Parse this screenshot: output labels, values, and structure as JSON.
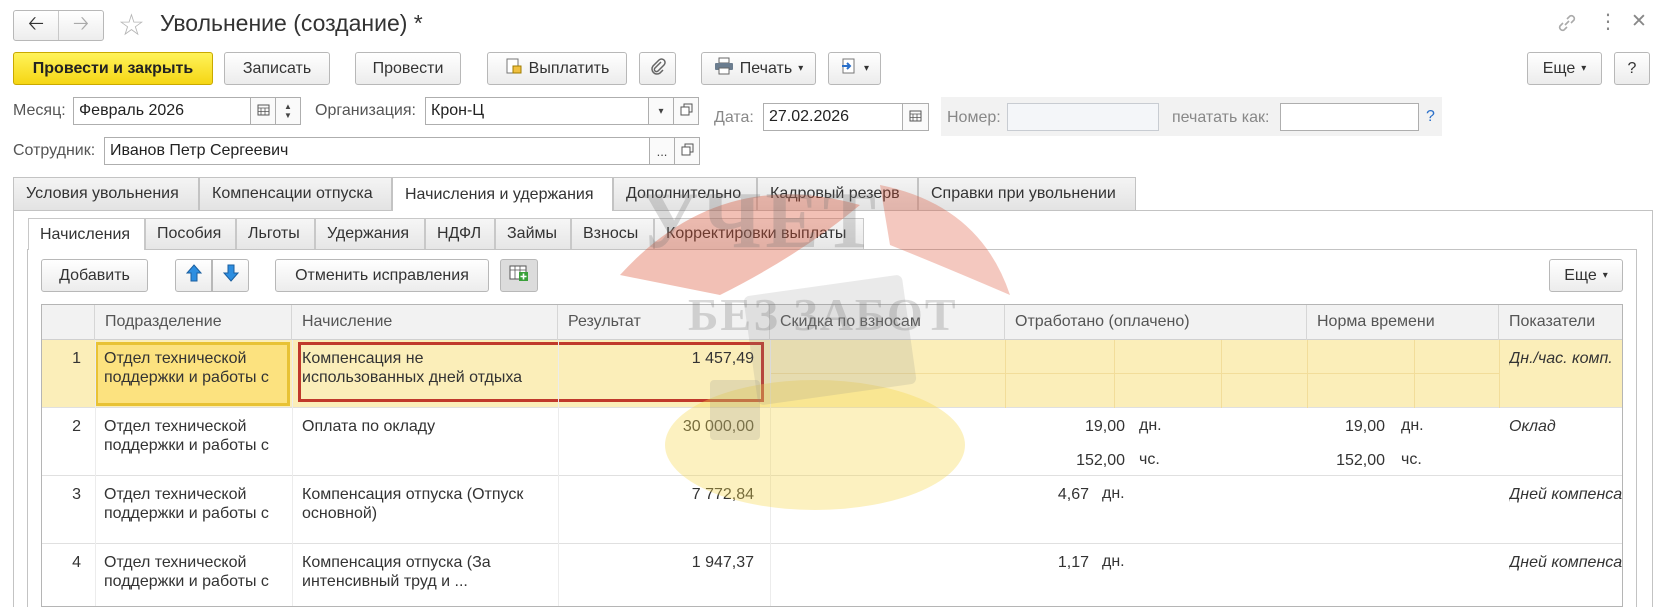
{
  "window": {
    "title": "Увольнение (создание) *"
  },
  "toolbar": {
    "post_close": "Провести и закрыть",
    "save": "Записать",
    "post": "Провести",
    "pay": "Выплатить",
    "print": "Печать",
    "more": "Еще",
    "help": "?"
  },
  "form": {
    "month_label": "Месяц:",
    "month_value": "Февраль 2026",
    "org_label": "Организация:",
    "org_value": "Крон-Ц",
    "date_label": "Дата:",
    "date_value": "27.02.2026",
    "number_label": "Номер:",
    "number_value": "",
    "print_as_label": "печатать как:",
    "print_as_value": "",
    "help_mark": "?",
    "employee_label": "Сотрудник:",
    "employee_value": "Иванов Петр Сергеевич",
    "dots": "..."
  },
  "tabs": [
    "Условия увольнения",
    "Компенсации отпуска",
    "Начисления и удержания",
    "Дополнительно",
    "Кадровый резерв",
    "Справки при увольнении"
  ],
  "subtabs": [
    "Начисления",
    "Пособия",
    "Льготы",
    "Удержания",
    "НДФЛ",
    "Займы",
    "Взносы",
    "Корректировки выплаты"
  ],
  "grid_toolbar": {
    "add": "Добавить",
    "cancel_fix": "Отменить исправления",
    "more": "Еще"
  },
  "table": {
    "headers": [
      "",
      "Подразделение",
      "Начисление",
      "Результат",
      "Скидка по взносам",
      "Отработано (оплачено)",
      "Норма времени",
      "Показатели"
    ],
    "rows": [
      {
        "n": "1",
        "dept": "Отдел технической поддержки и работы с",
        "accrual": "Компенсация не использованных дней отдыха",
        "result": "1 457,49",
        "worked1": "",
        "worked1_unit": "",
        "worked2": "",
        "worked2_unit": "",
        "norm1": "",
        "norm1_unit": "",
        "norm2": "",
        "norm2_unit": "",
        "indicator": "Дн./час. комп."
      },
      {
        "n": "2",
        "dept": "Отдел технической поддержки и работы с",
        "accrual": "Оплата по окладу",
        "result": "30 000,00",
        "worked1": "19,00",
        "worked1_unit": "дн.",
        "worked2": "152,00",
        "worked2_unit": "чс.",
        "norm1": "19,00",
        "norm1_unit": "дн.",
        "norm2": "152,00",
        "norm2_unit": "чс.",
        "indicator": "Оклад"
      },
      {
        "n": "3",
        "dept": "Отдел технической поддержки и работы с",
        "accrual": "Компенсация отпуска (Отпуск основной)",
        "result": "7 772,84",
        "worked1": "4,67",
        "worked1_unit": "дн.",
        "worked2": "",
        "worked2_unit": "",
        "norm1": "",
        "norm1_unit": "",
        "norm2": "",
        "norm2_unit": "",
        "indicator": "Дней компенса"
      },
      {
        "n": "4",
        "dept": "Отдел технической поддержки и работы с",
        "accrual": "Компенсация отпуска (За интенсивный труд и ...",
        "result": "1 947,37",
        "worked1": "1,17",
        "worked1_unit": "дн.",
        "worked2": "",
        "worked2_unit": "",
        "norm1": "",
        "norm1_unit": "",
        "norm2": "",
        "norm2_unit": "",
        "indicator": "Дней компенса"
      }
    ]
  },
  "watermark": {
    "line1": "УЧЕТ",
    "line2": "БЕЗ ЗАБОТ"
  },
  "colors": {
    "primary_button": "#f5d614",
    "selected_row": "#fbeeb9",
    "highlight_box": "#c0392b",
    "selected_cell_border": "#e8c234"
  },
  "icons": [
    "back-arrow-icon",
    "forward-arrow-icon",
    "star-icon",
    "link-icon",
    "kebab-menu-icon",
    "close-icon",
    "paperclip-icon",
    "printer-icon",
    "calendar-icon",
    "arrow-up-icon",
    "arrow-down-icon",
    "table-add-icon"
  ]
}
